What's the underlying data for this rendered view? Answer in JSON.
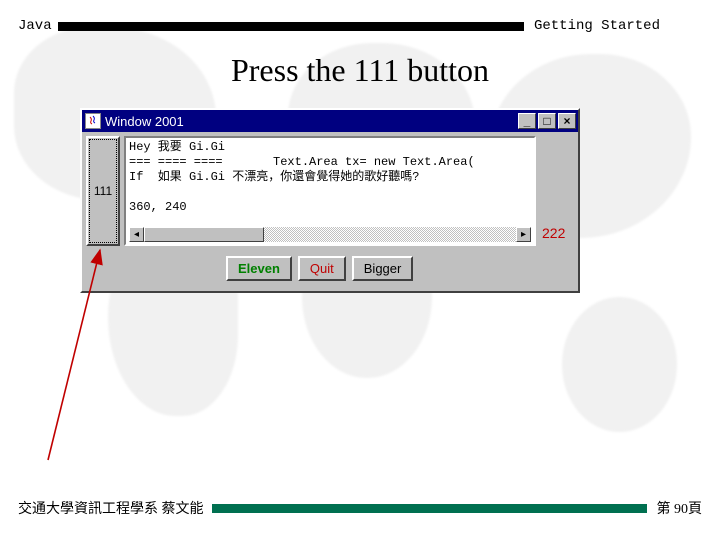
{
  "header": {
    "left": "Java",
    "right": "Getting Started"
  },
  "title": "Press the 111 button",
  "window": {
    "title": "Window 2001",
    "controls": {
      "min": "_",
      "max": "□",
      "close": "×"
    },
    "left_button": "111",
    "right_label": "222",
    "textarea_text": "Hey 我要 Gi.Gi\n=== ==== ====       Text.Area tx= new Text.Area(\nIf  如果 Gi.Gi 不漂亮，你還會覺得她的歌好聽嗎?\n\n360, 240",
    "scrollbar": {
      "left": "◂",
      "right": "▸"
    },
    "buttons": {
      "eleven": "Eleven",
      "quit": "Quit",
      "bigger": "Bigger"
    }
  },
  "footer": {
    "left": "交通大學資訊工程學系 蔡文能",
    "right": "第 90頁"
  }
}
